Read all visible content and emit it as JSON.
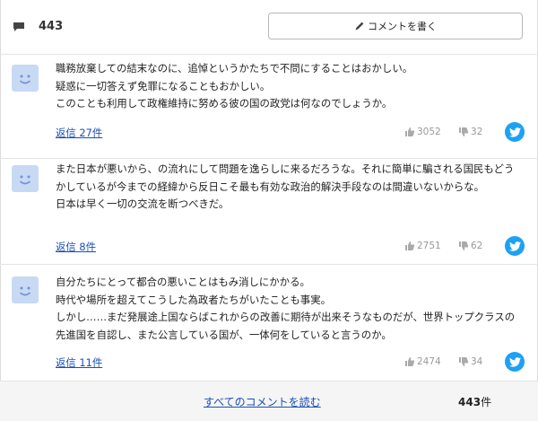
{
  "header": {
    "comment_count": "443",
    "write_button_label": "コメントを書く"
  },
  "comments": [
    {
      "text": "職務放棄しての結末なのに、追悼というかたちで不問にすることはおかしい。\n疑惑に一切答えず免罪になることもおかしい。\nこのことも利用して政権維持に努める彼の国の政党は何なのでしょうか。",
      "reply_label": "返信 27件",
      "likes": "3052",
      "dislikes": "32"
    },
    {
      "text": "また日本が悪いから、の流れにして問題を逸らしに来るだろうな。それに簡単に騙される国民もどうかしているが今までの経緯から反日こそ最も有効な政治的解決手段なのは間違いないからな。\n日本は早く一切の交流を断つべきだ。",
      "reply_label": "返信 8件",
      "likes": "2751",
      "dislikes": "62"
    },
    {
      "text": "自分たちにとって都合の悪いことはもみ消しにかかる。\n時代や場所を超えてこうした為政者たちがいたことも事実。\nしかし……まだ発展途上国ならばこれからの改善に期待が出来そうなものだが、世界トップクラスの先進国を自認し、また公言している国が、一体何をしていると言うのか。",
      "reply_label": "返信 11件",
      "likes": "2474",
      "dislikes": "34"
    }
  ],
  "footer": {
    "read_all_label": "すべてのコメントを読む",
    "total_number": "443",
    "total_unit": "件"
  },
  "colors": {
    "avatar_bg": "#c8d9f4",
    "avatar_face": "#6f93d6",
    "link": "#1a4fb5",
    "twitter": "#1da1f2"
  }
}
